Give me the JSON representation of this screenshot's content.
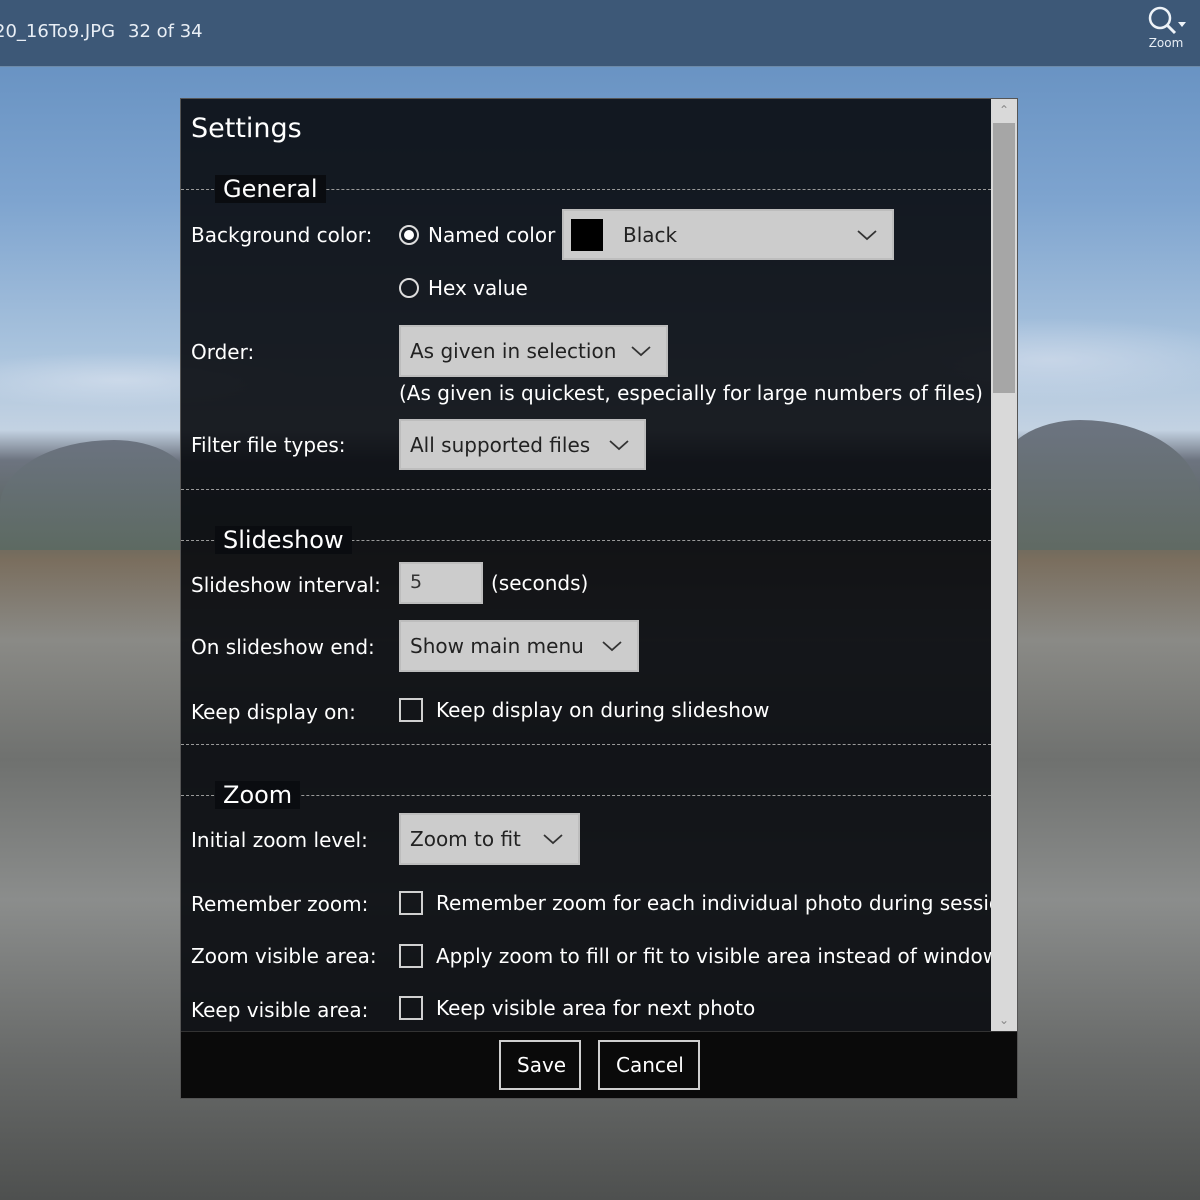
{
  "topbar": {
    "filename": "20_16To9.JPG",
    "counter": "32 of 34",
    "zoom_label": "Zoom"
  },
  "dialog": {
    "title": "Settings",
    "general": {
      "heading": "General",
      "background_label": "Background color:",
      "named_color_label": "Named color",
      "named_color_selected": true,
      "color_value": "Black",
      "swatch_color": "#000000",
      "hex_value_label": "Hex value",
      "order_label": "Order:",
      "order_value": "As given in selection",
      "order_note": "(As given is quickest, especially for large numbers of files)",
      "filter_label": "Filter file types:",
      "filter_value": "All supported files"
    },
    "slideshow": {
      "heading": "Slideshow",
      "interval_label": "Slideshow interval:",
      "interval_value": "5",
      "interval_unit": "(seconds)",
      "end_label": "On slideshow end:",
      "end_value": "Show main menu",
      "keep_display_label": "Keep display on:",
      "keep_display_text": "Keep display on during slideshow"
    },
    "zoom": {
      "heading": "Zoom",
      "initial_label": "Initial zoom level:",
      "initial_value": "Zoom to fit",
      "remember_label": "Remember zoom:",
      "remember_text": "Remember zoom for each individual photo during session",
      "visible_label": "Zoom visible area:",
      "visible_text": "Apply zoom to fill or fit to visible area instead of window",
      "keep_label": "Keep visible area:",
      "keep_text": "Keep visible area for next photo"
    },
    "footer": {
      "save": "Save",
      "cancel": "Cancel"
    }
  }
}
